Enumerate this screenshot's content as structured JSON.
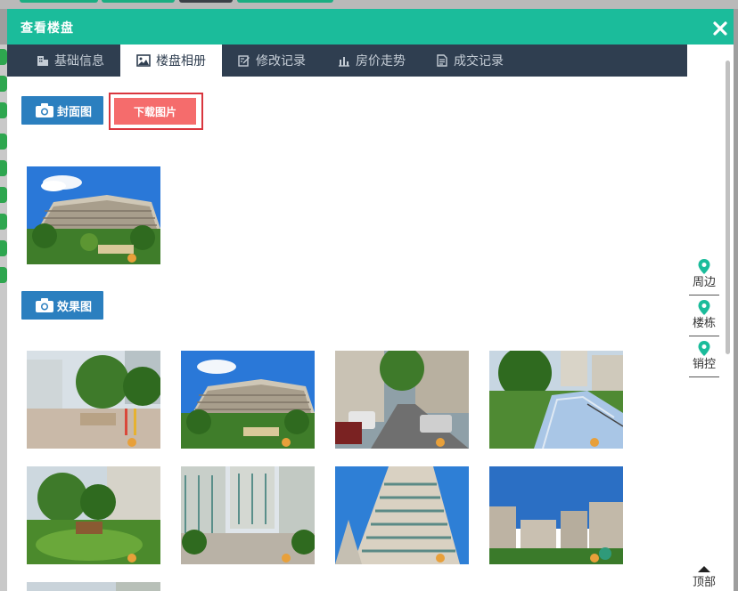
{
  "modal": {
    "title": "查看楼盘"
  },
  "tabs": [
    {
      "label": "基础信息",
      "icon": "building-icon"
    },
    {
      "label": "楼盘相册",
      "icon": "image-icon"
    },
    {
      "label": "修改记录",
      "icon": "edit-icon"
    },
    {
      "label": "房价走势",
      "icon": "bar-chart-icon"
    },
    {
      "label": "成交记录",
      "icon": "document-icon"
    }
  ],
  "active_tab": "楼盘相册",
  "sections": {
    "cover_label": "封面图",
    "download_label": "下载图片",
    "render_label": "效果图"
  },
  "side_nav": [
    {
      "label": "周边"
    },
    {
      "label": "楼栋"
    },
    {
      "label": "销控"
    }
  ],
  "back_to_top": "顶部",
  "colors": {
    "header": "#1bbc9b",
    "tabbar": "#2f3e50",
    "section_button": "#2b7fbf",
    "download_button": "#f56c6c",
    "highlight_border": "#d9363e",
    "pin": "#1bbc9b"
  }
}
